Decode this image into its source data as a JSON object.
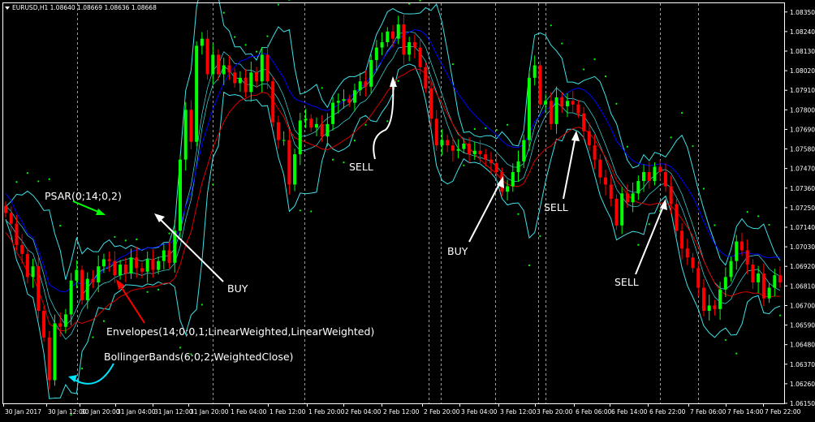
{
  "chart_data": {
    "type": "candlestick",
    "symbol_header": "EURUSD,H1  1.08640 1.08669 1.08636 1.08668",
    "ylim": [
      1.0615,
      1.084
    ],
    "y_ticks": [
      "1.08350",
      "1.08240",
      "1.08130",
      "1.08020",
      "1.07910",
      "1.07800",
      "1.07690",
      "1.07580",
      "1.07470",
      "1.07360",
      "1.07250",
      "1.07140",
      "1.07030",
      "1.06920",
      "1.06810",
      "1.06700",
      "1.06590",
      "1.06480",
      "1.06370",
      "1.06260",
      "1.06150"
    ],
    "x_ticks": [
      "30 Jan 2017",
      "30 Jan 12:00",
      "30 Jan 20:00",
      "31 Jan 04:00",
      "31 Jan 12:00",
      "31 Jan 20:00",
      "1 Feb 04:00",
      "1 Feb 12:00",
      "1 Feb 20:00",
      "2 Feb 04:00",
      "2 Feb 12:00",
      "2 Feb 20:00",
      "3 Feb 04:00",
      "3 Feb 12:00",
      "3 Feb 20:00",
      "6 Feb 06:00",
      "6 Feb 14:00",
      "6 Feb 22:00",
      "7 Feb 06:00",
      "7 Feb 14:00",
      "7 Feb 22:00"
    ],
    "grid": "vertical-dashed",
    "colors": {
      "bull": "#00ff00",
      "bear": "#ff0000",
      "bollinger": "#40e0e6",
      "envelope_upper": "#0000ff",
      "envelope_lower": "#dc0000",
      "psar": "#00ff00",
      "annotation_green": "#00ff00",
      "annotation_red": "#ff0000",
      "annotation_white": "#ffffff",
      "annotation_cyan": "#00e5ff"
    },
    "closes": [
      1.0722,
      1.0716,
      1.0704,
      1.0699,
      1.0686,
      1.0692,
      1.0667,
      1.0652,
      1.0628,
      1.066,
      1.0658,
      1.0665,
      1.0684,
      1.069,
      1.0673,
      1.0685,
      1.0683,
      1.0692,
      1.0696,
      1.0695,
      1.0687,
      1.0693,
      1.0688,
      1.0697,
      1.0691,
      1.0689,
      1.0696,
      1.069,
      1.0695,
      1.0701,
      1.0694,
      1.0712,
      1.0752,
      1.078,
      1.0762,
      1.0816,
      1.082,
      1.08,
      1.0811,
      1.08,
      1.0805,
      1.0801,
      1.0795,
      1.0798,
      1.079,
      1.0801,
      1.0796,
      1.0811,
      1.0796,
      1.0773,
      1.0763,
      1.0763,
      1.0738,
      1.0755,
      1.0774,
      1.0775,
      1.077,
      1.0772,
      1.0765,
      1.0772,
      1.0784,
      1.0785,
      1.0786,
      1.0784,
      1.0791,
      1.0796,
      1.0793,
      1.0808,
      1.0815,
      1.0818,
      1.0824,
      1.082,
      1.0828,
      1.0811,
      1.0818,
      1.0815,
      1.0804,
      1.0792,
      1.0775,
      1.076,
      1.0763,
      1.076,
      1.0757,
      1.0758,
      1.0761,
      1.0755,
      1.0757,
      1.0755,
      1.0752,
      1.075,
      1.0745,
      1.0734,
      1.0737,
      1.0745,
      1.0751,
      1.0763,
      1.0798,
      1.0805,
      1.0783,
      1.0785,
      1.0772,
      1.0787,
      1.0782,
      1.0785,
      1.0783,
      1.0778,
      1.0768,
      1.076,
      1.0752,
      1.0742,
      1.0738,
      1.073,
      1.0715,
      1.0733,
      1.0728,
      1.0733,
      1.074,
      1.0745,
      1.074,
      1.0748,
      1.0745,
      1.0737,
      1.0727,
      1.0712,
      1.0702,
      1.0697,
      1.0691,
      1.068,
      1.0667,
      1.067,
      1.0668,
      1.0679,
      1.0686,
      1.0695,
      1.0706,
      1.0701,
      1.0693,
      1.0683,
      1.0688,
      1.0674,
      1.068,
      1.0687,
      1.0683
    ]
  },
  "annotations": {
    "psar_label": "PSAR(0;14;0,2)",
    "buy1": "BUY",
    "envelopes_label": "Envelopes(14;0;0,1;LinearWeighted,LinearWeighted)",
    "bollinger_label": "BollingerBands(6;0;2;WeightedClose)",
    "sell1": "SELL",
    "buy2": "BUY",
    "sell2": "SELL",
    "sell3": "SELL"
  }
}
